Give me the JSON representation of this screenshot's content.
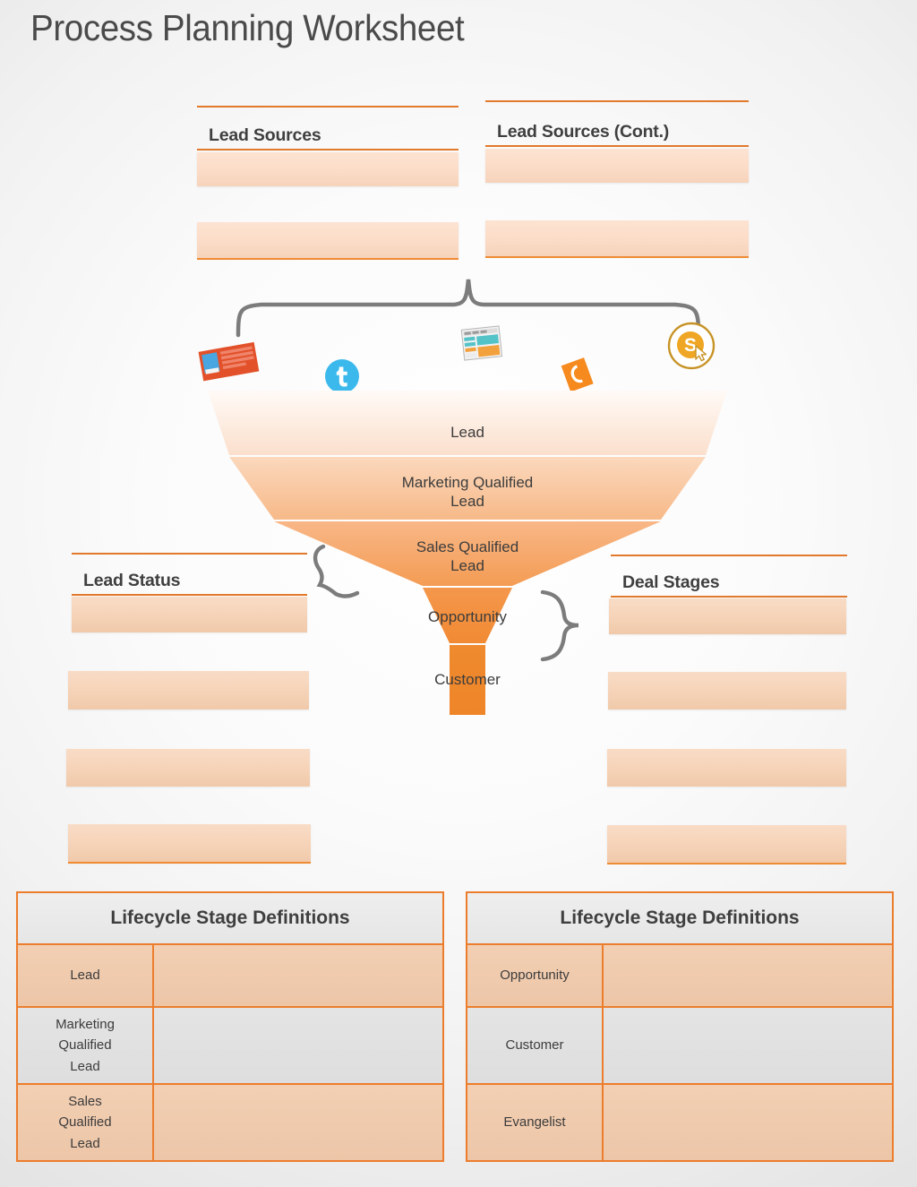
{
  "page": {
    "title": "Process Planning Worksheet"
  },
  "lead_sources": {
    "heading": "Lead Sources",
    "boxes": [
      "",
      ""
    ]
  },
  "lead_sources_cont": {
    "heading": "Lead Sources (Cont.)",
    "boxes": [
      "",
      ""
    ]
  },
  "source_icons": [
    {
      "name": "email-newsletter-icon",
      "label": "Email"
    },
    {
      "name": "twitter-icon",
      "label": "Twitter"
    },
    {
      "name": "blog-webpage-icon",
      "label": "Blog"
    },
    {
      "name": "phone-call-icon",
      "label": "Phone"
    },
    {
      "name": "paid-search-ppc-icon",
      "label": "Paid Search"
    }
  ],
  "funnel": {
    "stages": [
      {
        "name": "lead",
        "label": "Lead"
      },
      {
        "name": "marketing-qualified-lead",
        "label": "Marketing Qualified\nLead"
      },
      {
        "name": "sales-qualified-lead",
        "label": "Sales Qualified\nLead"
      },
      {
        "name": "opportunity",
        "label": "Opportunity"
      },
      {
        "name": "customer",
        "label": "Customer"
      }
    ]
  },
  "lead_status": {
    "heading": "Lead Status",
    "boxes": [
      "",
      "",
      "",
      ""
    ]
  },
  "deal_stages": {
    "heading": "Deal Stages",
    "boxes": [
      "",
      "",
      "",
      ""
    ]
  },
  "definitions_left": {
    "title": "Lifecycle Stage Definitions",
    "rows": [
      {
        "stage": "Lead",
        "definition": ""
      },
      {
        "stage": "Marketing\nQualified\nLead",
        "definition": ""
      },
      {
        "stage": "Sales\nQualified\nLead",
        "definition": ""
      }
    ]
  },
  "definitions_right": {
    "title": "Lifecycle Stage Definitions",
    "rows": [
      {
        "stage": "Opportunity",
        "definition": ""
      },
      {
        "stage": "Customer",
        "definition": ""
      },
      {
        "stage": "Evangelist",
        "definition": ""
      }
    ]
  },
  "colors": {
    "accent_orange": "#ec7d2d",
    "rule_orange": "#e2792b",
    "fill_peach": "#fbdcc7",
    "funnel_deep": "#f0872d",
    "text_dark": "#3c3c3c",
    "twitter_blue": "#3cb9ec"
  }
}
